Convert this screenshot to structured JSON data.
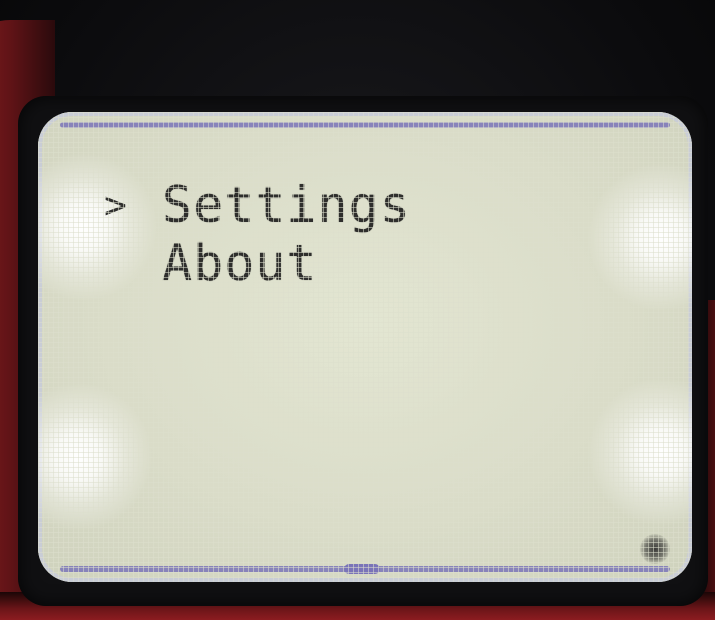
{
  "menu": {
    "items": [
      {
        "label": "Settings",
        "selected": true,
        "cursor": ">"
      },
      {
        "label": "About",
        "selected": false,
        "cursor": ">"
      }
    ]
  },
  "colors": {
    "lcd_background": "#dadcc8",
    "pixel_on": "#2e2e2c",
    "frame_accent": "#7a74b8",
    "pcb": "#8a1e22"
  },
  "icons": {
    "selection": "chevron-right-icon"
  }
}
